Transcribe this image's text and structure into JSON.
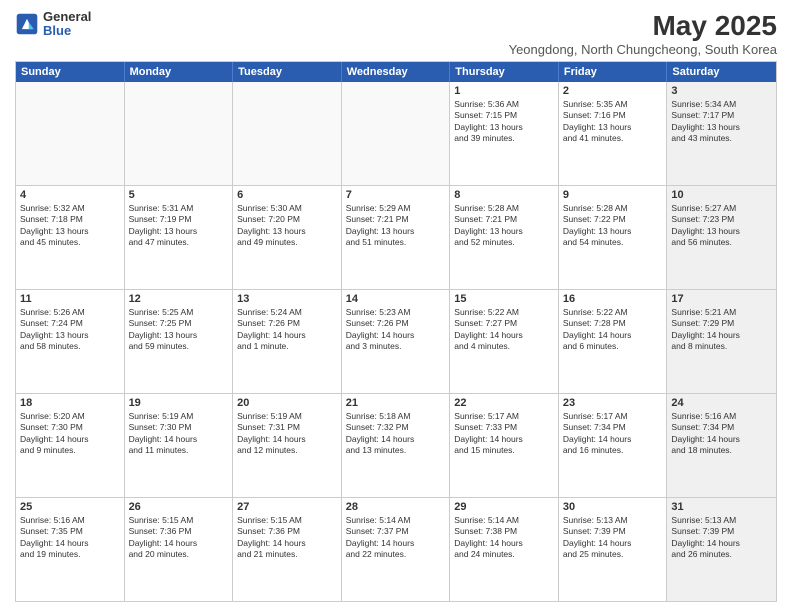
{
  "logo": {
    "general": "General",
    "blue": "Blue"
  },
  "title": "May 2025",
  "subtitle": "Yeongdong, North Chungcheong, South Korea",
  "weekdays": [
    "Sunday",
    "Monday",
    "Tuesday",
    "Wednesday",
    "Thursday",
    "Friday",
    "Saturday"
  ],
  "rows": [
    [
      {
        "day": "",
        "info": "",
        "empty": true
      },
      {
        "day": "",
        "info": "",
        "empty": true
      },
      {
        "day": "",
        "info": "",
        "empty": true
      },
      {
        "day": "",
        "info": "",
        "empty": true
      },
      {
        "day": "1",
        "info": "Sunrise: 5:36 AM\nSunset: 7:15 PM\nDaylight: 13 hours\nand 39 minutes."
      },
      {
        "day": "2",
        "info": "Sunrise: 5:35 AM\nSunset: 7:16 PM\nDaylight: 13 hours\nand 41 minutes."
      },
      {
        "day": "3",
        "info": "Sunrise: 5:34 AM\nSunset: 7:17 PM\nDaylight: 13 hours\nand 43 minutes.",
        "shaded": true
      }
    ],
    [
      {
        "day": "4",
        "info": "Sunrise: 5:32 AM\nSunset: 7:18 PM\nDaylight: 13 hours\nand 45 minutes."
      },
      {
        "day": "5",
        "info": "Sunrise: 5:31 AM\nSunset: 7:19 PM\nDaylight: 13 hours\nand 47 minutes."
      },
      {
        "day": "6",
        "info": "Sunrise: 5:30 AM\nSunset: 7:20 PM\nDaylight: 13 hours\nand 49 minutes."
      },
      {
        "day": "7",
        "info": "Sunrise: 5:29 AM\nSunset: 7:21 PM\nDaylight: 13 hours\nand 51 minutes."
      },
      {
        "day": "8",
        "info": "Sunrise: 5:28 AM\nSunset: 7:21 PM\nDaylight: 13 hours\nand 52 minutes."
      },
      {
        "day": "9",
        "info": "Sunrise: 5:28 AM\nSunset: 7:22 PM\nDaylight: 13 hours\nand 54 minutes."
      },
      {
        "day": "10",
        "info": "Sunrise: 5:27 AM\nSunset: 7:23 PM\nDaylight: 13 hours\nand 56 minutes.",
        "shaded": true
      }
    ],
    [
      {
        "day": "11",
        "info": "Sunrise: 5:26 AM\nSunset: 7:24 PM\nDaylight: 13 hours\nand 58 minutes."
      },
      {
        "day": "12",
        "info": "Sunrise: 5:25 AM\nSunset: 7:25 PM\nDaylight: 13 hours\nand 59 minutes."
      },
      {
        "day": "13",
        "info": "Sunrise: 5:24 AM\nSunset: 7:26 PM\nDaylight: 14 hours\nand 1 minute."
      },
      {
        "day": "14",
        "info": "Sunrise: 5:23 AM\nSunset: 7:26 PM\nDaylight: 14 hours\nand 3 minutes."
      },
      {
        "day": "15",
        "info": "Sunrise: 5:22 AM\nSunset: 7:27 PM\nDaylight: 14 hours\nand 4 minutes."
      },
      {
        "day": "16",
        "info": "Sunrise: 5:22 AM\nSunset: 7:28 PM\nDaylight: 14 hours\nand 6 minutes."
      },
      {
        "day": "17",
        "info": "Sunrise: 5:21 AM\nSunset: 7:29 PM\nDaylight: 14 hours\nand 8 minutes.",
        "shaded": true
      }
    ],
    [
      {
        "day": "18",
        "info": "Sunrise: 5:20 AM\nSunset: 7:30 PM\nDaylight: 14 hours\nand 9 minutes."
      },
      {
        "day": "19",
        "info": "Sunrise: 5:19 AM\nSunset: 7:30 PM\nDaylight: 14 hours\nand 11 minutes."
      },
      {
        "day": "20",
        "info": "Sunrise: 5:19 AM\nSunset: 7:31 PM\nDaylight: 14 hours\nand 12 minutes."
      },
      {
        "day": "21",
        "info": "Sunrise: 5:18 AM\nSunset: 7:32 PM\nDaylight: 14 hours\nand 13 minutes."
      },
      {
        "day": "22",
        "info": "Sunrise: 5:17 AM\nSunset: 7:33 PM\nDaylight: 14 hours\nand 15 minutes."
      },
      {
        "day": "23",
        "info": "Sunrise: 5:17 AM\nSunset: 7:34 PM\nDaylight: 14 hours\nand 16 minutes."
      },
      {
        "day": "24",
        "info": "Sunrise: 5:16 AM\nSunset: 7:34 PM\nDaylight: 14 hours\nand 18 minutes.",
        "shaded": true
      }
    ],
    [
      {
        "day": "25",
        "info": "Sunrise: 5:16 AM\nSunset: 7:35 PM\nDaylight: 14 hours\nand 19 minutes."
      },
      {
        "day": "26",
        "info": "Sunrise: 5:15 AM\nSunset: 7:36 PM\nDaylight: 14 hours\nand 20 minutes."
      },
      {
        "day": "27",
        "info": "Sunrise: 5:15 AM\nSunset: 7:36 PM\nDaylight: 14 hours\nand 21 minutes."
      },
      {
        "day": "28",
        "info": "Sunrise: 5:14 AM\nSunset: 7:37 PM\nDaylight: 14 hours\nand 22 minutes."
      },
      {
        "day": "29",
        "info": "Sunrise: 5:14 AM\nSunset: 7:38 PM\nDaylight: 14 hours\nand 24 minutes."
      },
      {
        "day": "30",
        "info": "Sunrise: 5:13 AM\nSunset: 7:39 PM\nDaylight: 14 hours\nand 25 minutes."
      },
      {
        "day": "31",
        "info": "Sunrise: 5:13 AM\nSunset: 7:39 PM\nDaylight: 14 hours\nand 26 minutes.",
        "shaded": true
      }
    ]
  ]
}
